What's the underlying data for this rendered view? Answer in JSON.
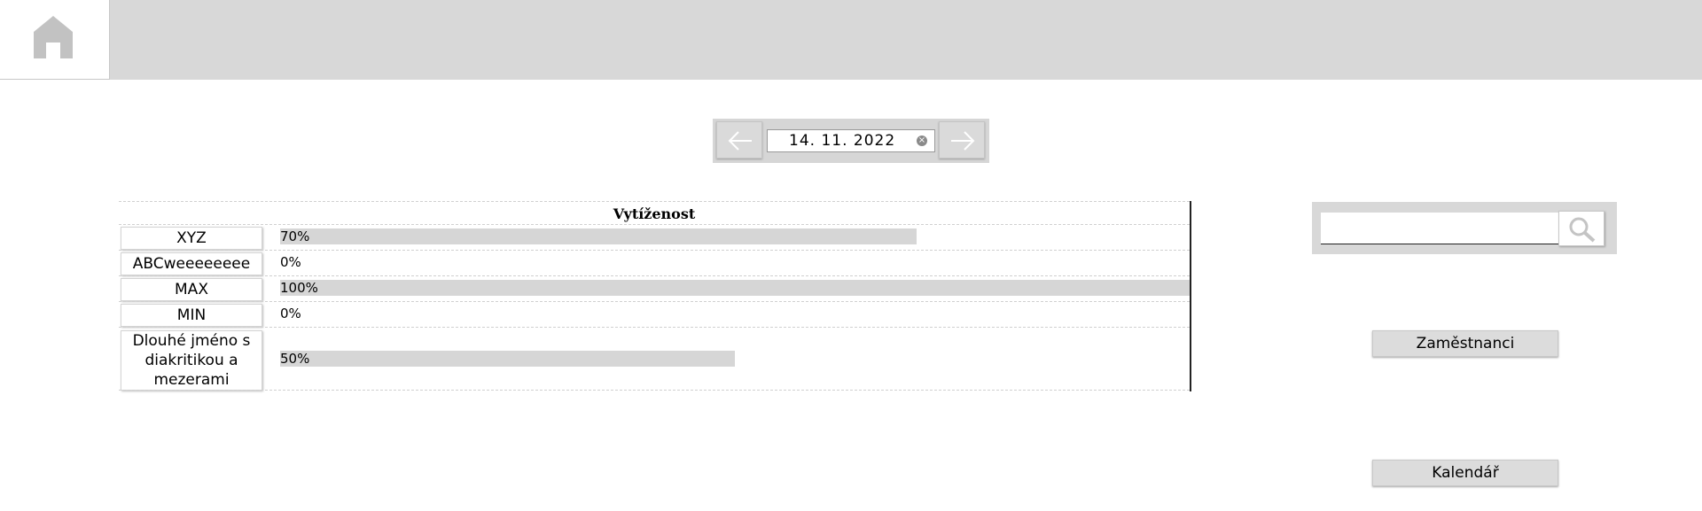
{
  "nav": {
    "home_icon": "home-icon"
  },
  "date_picker": {
    "value": "14. 11. 2022",
    "clear_glyph": "×",
    "prev_icon": "arrow-left-icon",
    "next_icon": "arrow-right-icon"
  },
  "utilization": {
    "title": "Vytíženost",
    "rows": [
      {
        "name": "XYZ",
        "percent_label": "70%",
        "fraction": 0.7
      },
      {
        "name": "ABCweeeeeeee",
        "percent_label": "0%",
        "fraction": 0.0
      },
      {
        "name": "MAX",
        "percent_label": "100%",
        "fraction": 1.0
      },
      {
        "name": "MIN",
        "percent_label": "0%",
        "fraction": 0.0
      },
      {
        "name": "Dlouhé jméno s diakritikou a mezerami",
        "percent_label": "50%",
        "fraction": 0.5
      }
    ],
    "bar_color": "#d6d6d6"
  },
  "search": {
    "placeholder": "",
    "icon": "search-icon"
  },
  "side_menu": {
    "employees_label": "Zaměstnanci",
    "calendar_label": "Kalendář"
  }
}
